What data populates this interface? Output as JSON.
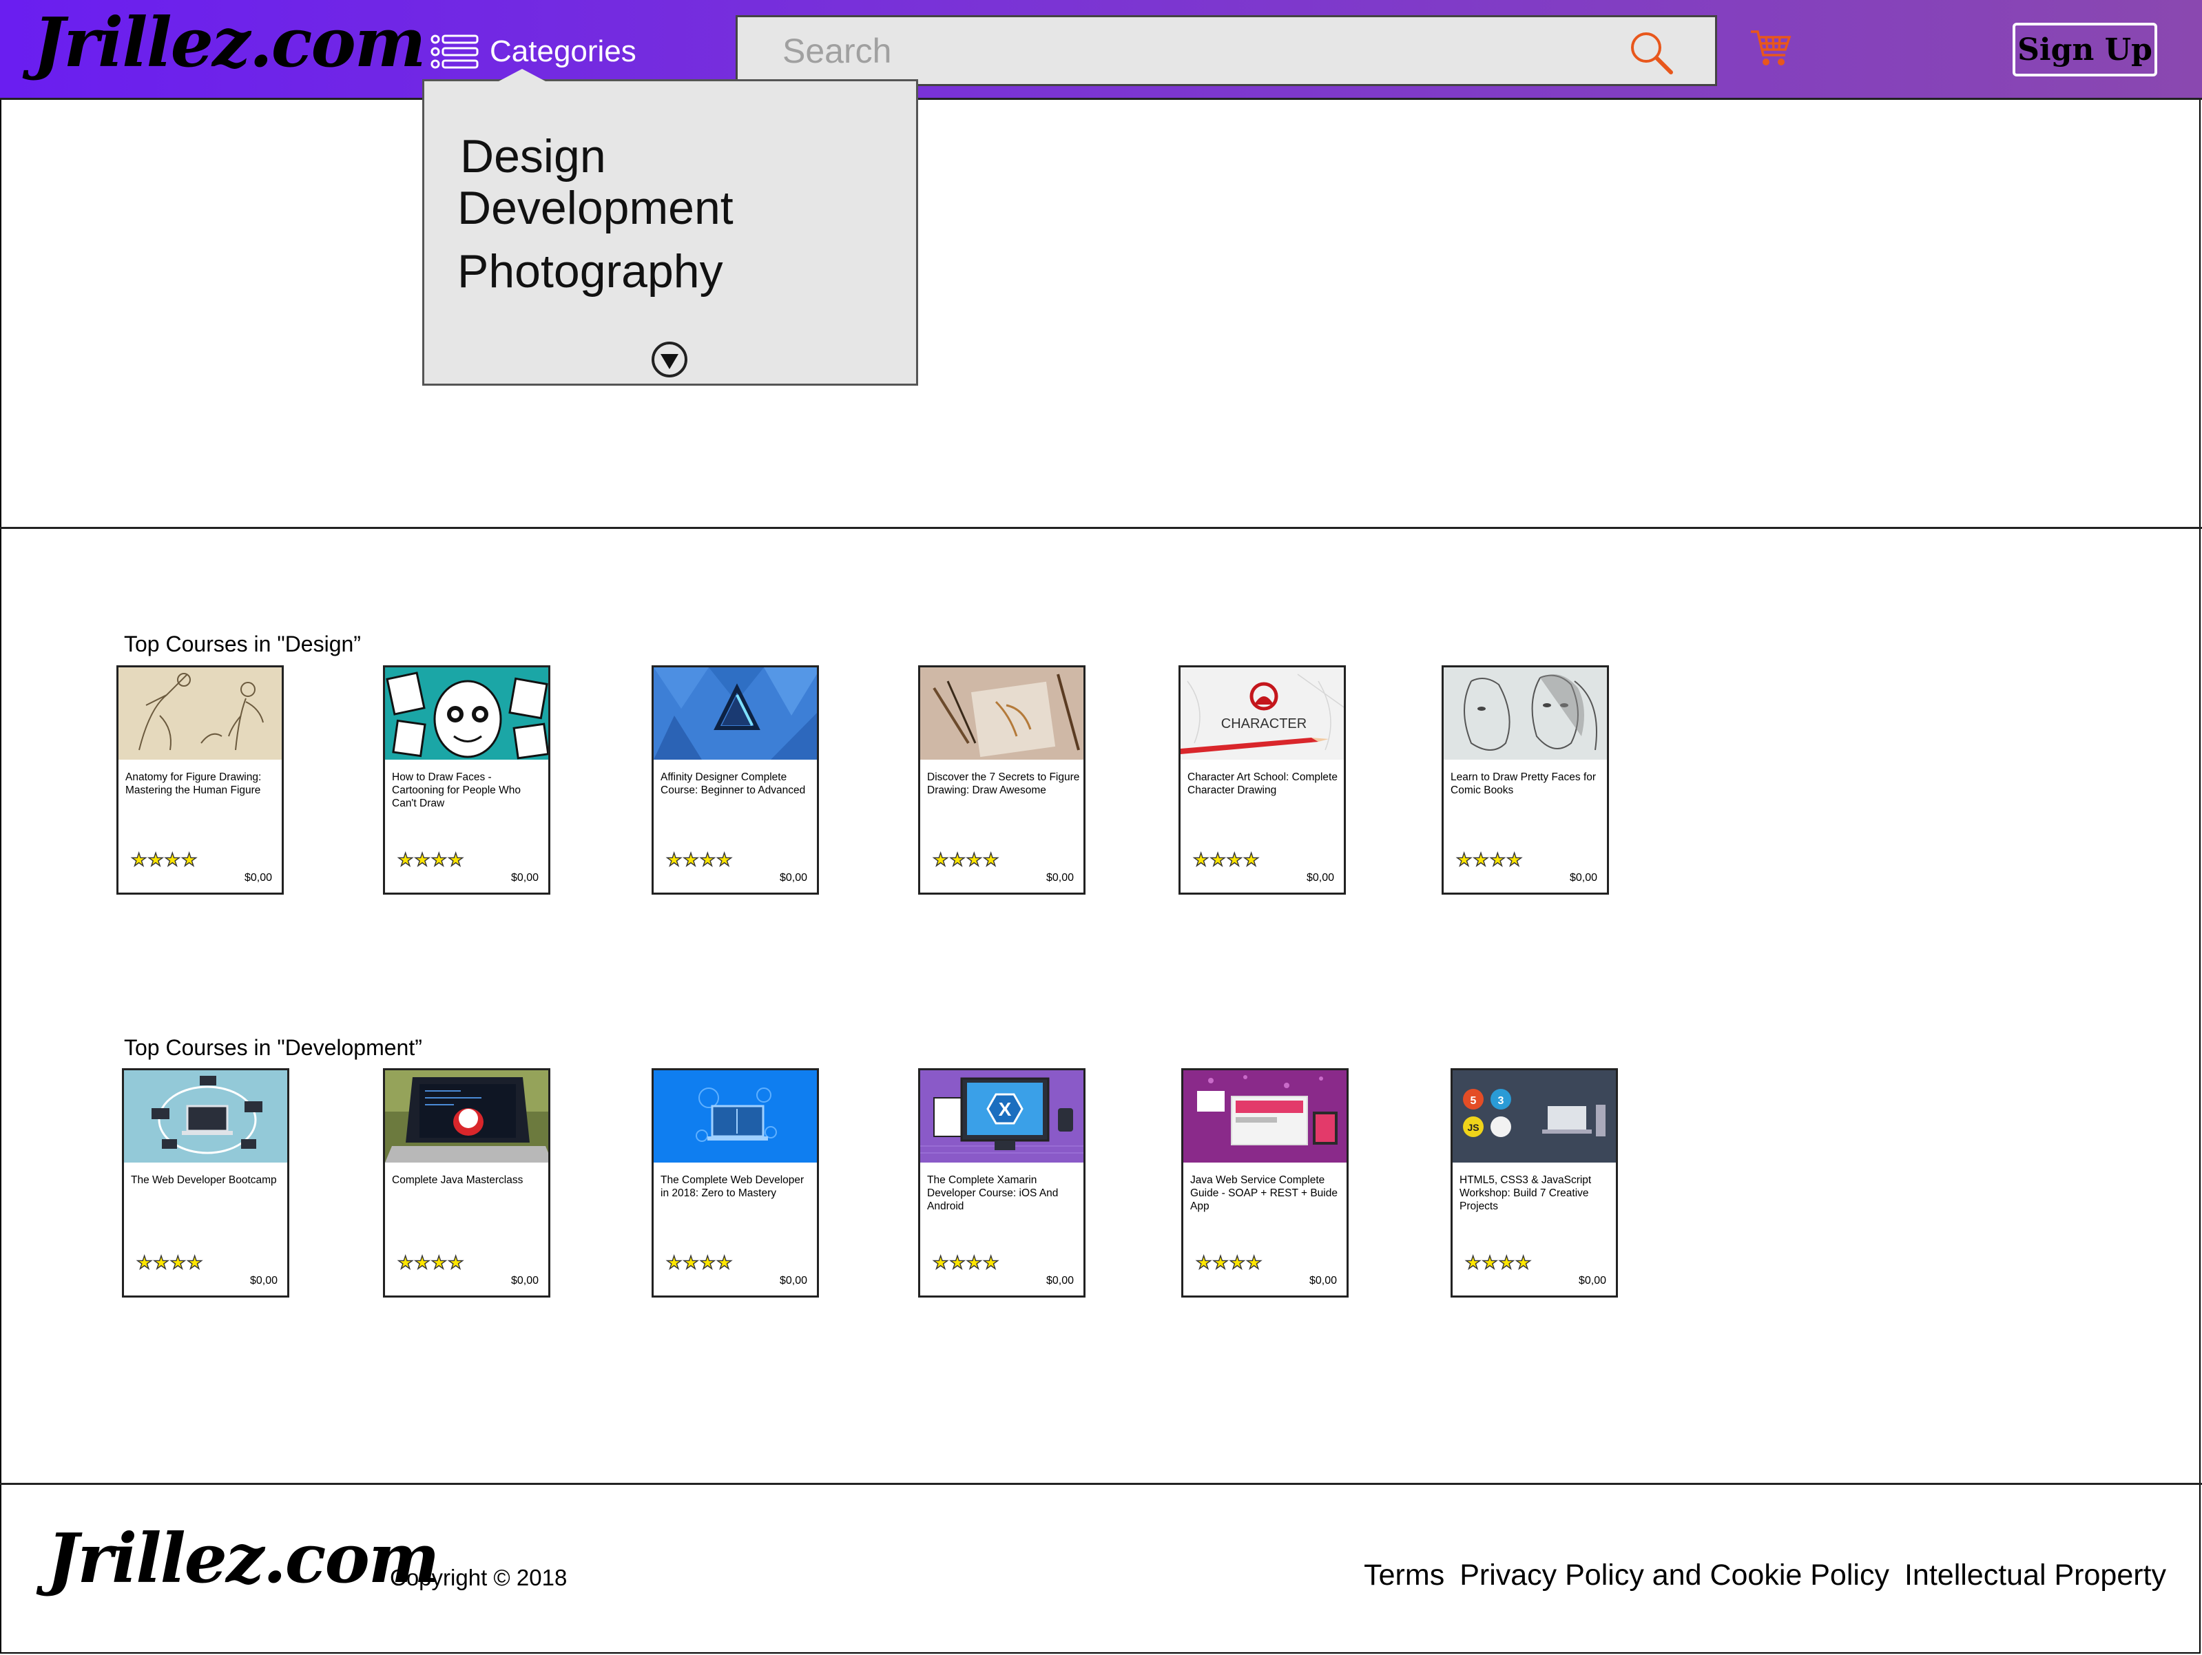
{
  "header": {
    "logo": "Jrillez.com",
    "categories_label": "Categories",
    "search_placeholder": "Search",
    "signup_label": "Sign Up"
  },
  "dropdown": {
    "items": [
      "Design",
      "Development",
      "Photography"
    ]
  },
  "sections": [
    {
      "title": "Top Courses in \"Design”",
      "courses": [
        {
          "title": "Anatomy for Figure Drawing: Mastering the Human Figure",
          "rating": 4,
          "price": "$0,00"
        },
        {
          "title": "How to Draw Faces - Cartooning for People Who Can't Draw",
          "rating": 4,
          "price": "$0,00"
        },
        {
          "title": "Affinity Designer Complete Course: Beginner to Advanced",
          "rating": 4,
          "price": "$0,00"
        },
        {
          "title": "Discover the 7 Secrets to Figure Drawing: Draw Awesome",
          "rating": 4,
          "price": "$0,00"
        },
        {
          "title": "Character Art School: Complete Character Drawing",
          "rating": 4,
          "price": "$0,00"
        },
        {
          "title": "Learn to Draw Pretty Faces for Comic Books",
          "rating": 4,
          "price": "$0,00"
        }
      ]
    },
    {
      "title": "Top Courses in \"Development”",
      "courses": [
        {
          "title": "The Web Developer Bootcamp",
          "rating": 4,
          "price": "$0,00"
        },
        {
          "title": "Complete Java Masterclass",
          "rating": 4,
          "price": "$0,00"
        },
        {
          "title": "The Complete Web Developer in 2018: Zero to Mastery",
          "rating": 4,
          "price": "$0,00"
        },
        {
          "title": "The Complete Xamarin Developer Course: iOS And Android",
          "rating": 4,
          "price": "$0,00"
        },
        {
          "title": "Java Web Service Complete Guide - SOAP + REST + Buide App",
          "rating": 4,
          "price": "$0,00"
        },
        {
          "title": "HTML5, CSS3 & JavaScript Workshop: Build 7 Creative Projects",
          "rating": 4,
          "price": "$0,00"
        }
      ]
    }
  ],
  "thumb_text": {
    "character_art": "CHARACTER",
    "xamarin": "X",
    "html5": "5",
    "css3": "3",
    "js": "JS"
  },
  "footer": {
    "logo": "Jrillez.com",
    "copyright": "Copyright © 2018",
    "links": [
      "Terms",
      "Privacy Policy and Cookie Policy",
      "Intellectual Property"
    ]
  },
  "colors": {
    "header_gradient_start": "#6a1ef0",
    "header_gradient_end": "#8a48b0",
    "cart": "#e8571c",
    "search_icon": "#e8571c",
    "star": "#ffe600"
  }
}
